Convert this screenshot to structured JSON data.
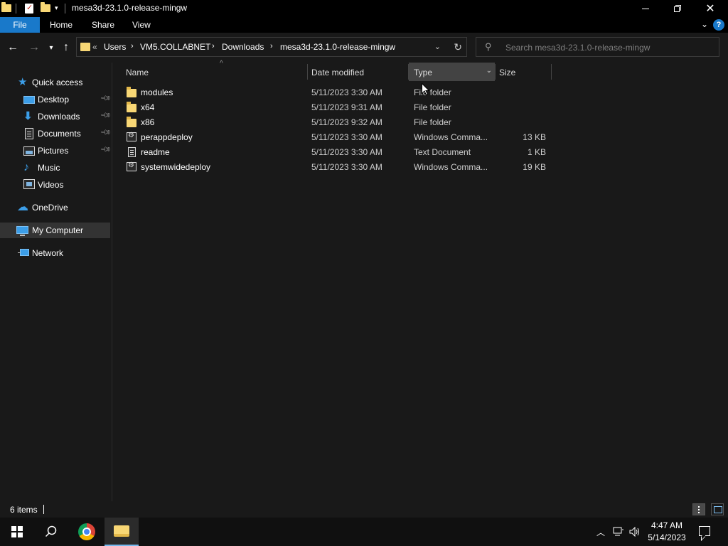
{
  "window": {
    "title": "mesa3d-23.1.0-release-mingw"
  },
  "ribbon": {
    "tabs": [
      "File",
      "Home",
      "Share",
      "View"
    ]
  },
  "address": {
    "overflow": "«",
    "crumbs": [
      "Users",
      "VM5.COLLABNET",
      "Downloads",
      "mesa3d-23.1.0-release-mingw"
    ]
  },
  "search": {
    "placeholder": "Search mesa3d-23.1.0-release-mingw"
  },
  "navpane": {
    "items": [
      {
        "label": "Quick access",
        "icon": "star-icon"
      },
      {
        "label": "Desktop",
        "icon": "desktop-icon",
        "pinned": true
      },
      {
        "label": "Downloads",
        "icon": "download-icon",
        "pinned": true
      },
      {
        "label": "Documents",
        "icon": "documents-icon",
        "pinned": true
      },
      {
        "label": "Pictures",
        "icon": "pictures-icon",
        "pinned": true
      },
      {
        "label": "Music",
        "icon": "music-icon"
      },
      {
        "label": "Videos",
        "icon": "videos-icon"
      },
      {
        "label": "OneDrive",
        "icon": "cloud-icon"
      },
      {
        "label": "My Computer",
        "icon": "computer-icon",
        "selected": true
      },
      {
        "label": "Network",
        "icon": "network-icon"
      }
    ]
  },
  "columns": {
    "name": "Name",
    "date": "Date modified",
    "type": "Type",
    "size": "Size"
  },
  "files": [
    {
      "name": "modules",
      "date": "5/11/2023 3:30 AM",
      "type": "File folder",
      "size": "",
      "icon": "folder-icon"
    },
    {
      "name": "x64",
      "date": "5/11/2023 9:31 AM",
      "type": "File folder",
      "size": "",
      "icon": "folder-icon"
    },
    {
      "name": "x86",
      "date": "5/11/2023 9:32 AM",
      "type": "File folder",
      "size": "",
      "icon": "folder-icon"
    },
    {
      "name": "perappdeploy",
      "date": "5/11/2023 3:30 AM",
      "type": "Windows Comma...",
      "size": "13 KB",
      "icon": "cmd-file-icon"
    },
    {
      "name": "readme",
      "date": "5/11/2023 3:30 AM",
      "type": "Text Document",
      "size": "1 KB",
      "icon": "text-file-icon"
    },
    {
      "name": "systemwidedeploy",
      "date": "5/11/2023 3:30 AM",
      "type": "Windows Comma...",
      "size": "19 KB",
      "icon": "cmd-file-icon"
    }
  ],
  "status": {
    "item_count": "6 items"
  },
  "taskbar": {
    "time": "4:47 AM",
    "date": "5/14/2023"
  },
  "colors": {
    "accent": "#1979ca",
    "folder": "#f8d775",
    "background": "#191919",
    "titlebar": "#000000"
  }
}
